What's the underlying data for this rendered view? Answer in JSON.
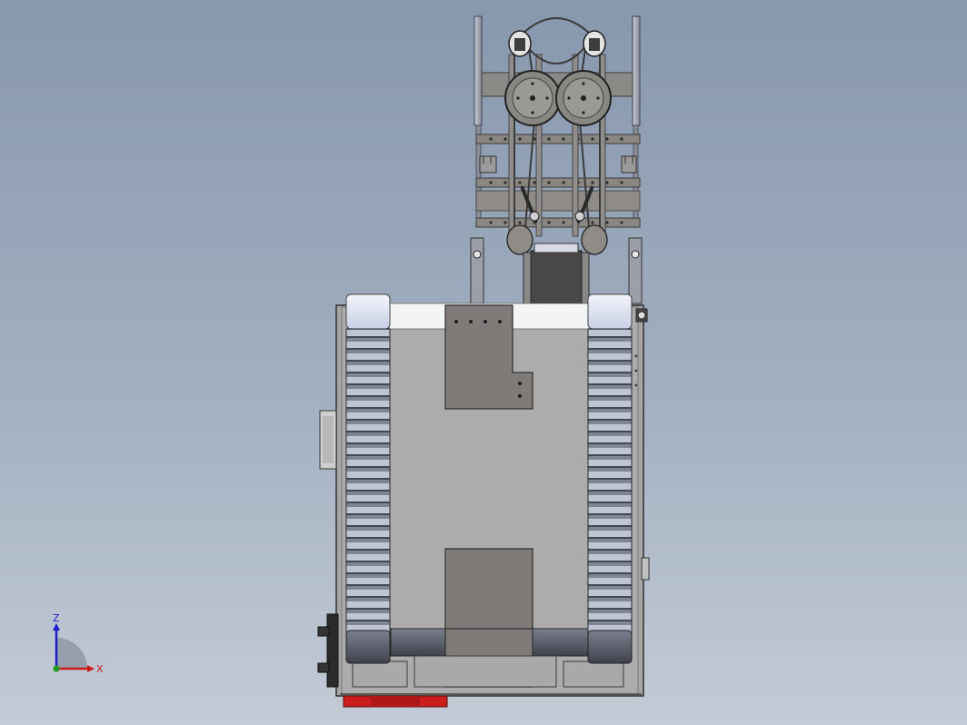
{
  "viewport": {
    "background_top": "#8797ad",
    "background_bottom": "#c3cbd6"
  },
  "model": {
    "body_color": "#a9a9a9",
    "panel_color": "#7d7a76",
    "track_highlight": "#e2e6f3",
    "base_accent": "#cc1d1d"
  },
  "triad": {
    "z_label": "Z",
    "x_label": "X",
    "z_color": "#1d1dcc",
    "x_color": "#cc1d1d",
    "y_color": "#1d9a1d"
  }
}
